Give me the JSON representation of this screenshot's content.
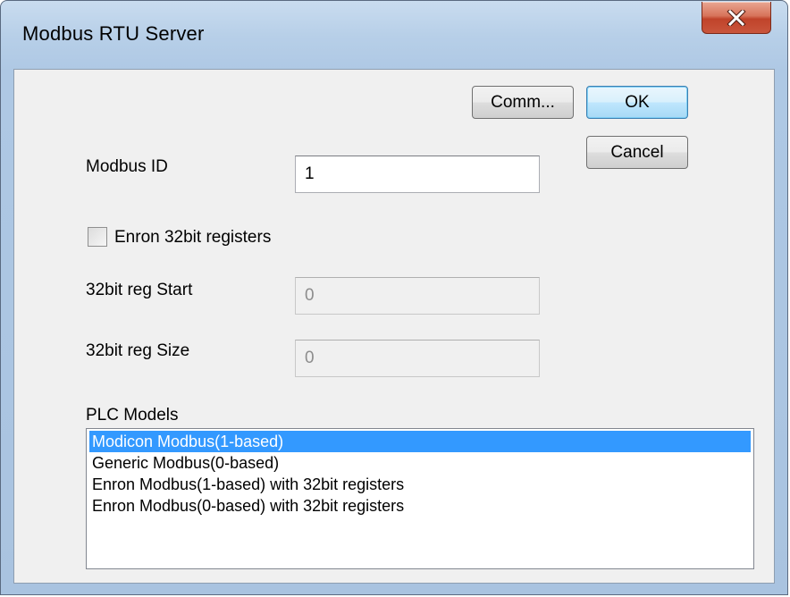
{
  "window": {
    "title": "Modbus RTU Server"
  },
  "buttons": {
    "comm": "Comm...",
    "ok": "OK",
    "cancel": "Cancel"
  },
  "modbus_id": {
    "label": "Modbus ID",
    "value": "1"
  },
  "enron": {
    "label": "Enron 32bit registers",
    "checked": false
  },
  "reg_start": {
    "label": "32bit reg Start",
    "value": "0"
  },
  "reg_size": {
    "label": "32bit reg Size",
    "value": "0"
  },
  "plc_models": {
    "label": "PLC Models",
    "items": [
      "Modicon Modbus(1-based)",
      "Generic Modbus(0-based)",
      "Enron Modbus(1-based) with 32bit registers",
      "Enron Modbus(0-based) with 32bit registers"
    ],
    "selected_index": 0
  },
  "colors": {
    "selection": "#3399ff",
    "close_button": "#c9553c"
  }
}
